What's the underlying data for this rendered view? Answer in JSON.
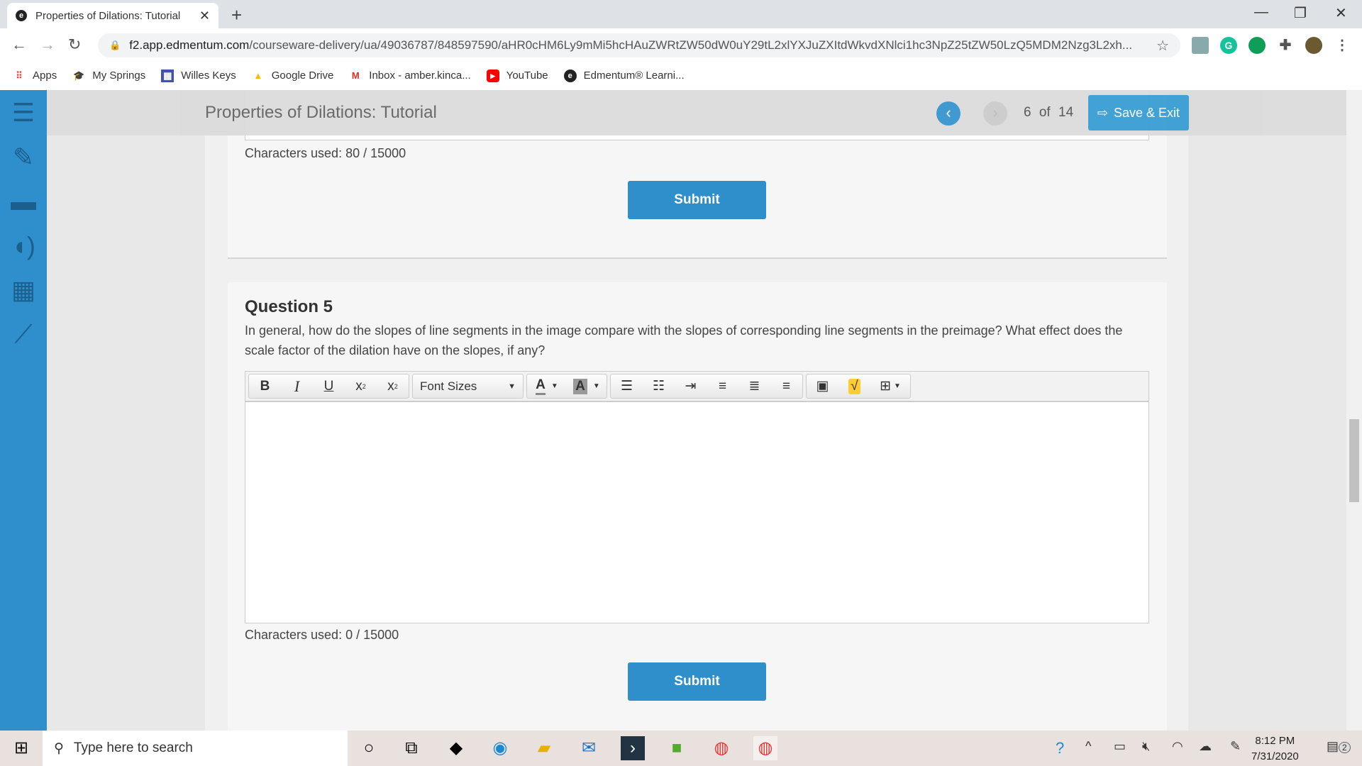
{
  "browser": {
    "tab_title": "Properties of Dilations: Tutorial",
    "url_host": "f2.app.edmentum.com",
    "url_path": "/courseware-delivery/ua/49036787/848597590/aHR0cHM6Ly9mMi5hcHAuZWRtZW50dW0uY29tL2xlYXJuZXItdWkvdXNlci1hc3NpZ25tZW50LzQ5MDM2Nzg3L2xh..."
  },
  "bookmarks": [
    {
      "label": "Apps",
      "icon": "apps-grid-icon"
    },
    {
      "label": "My Springs",
      "icon": "graduation-cap-icon"
    },
    {
      "label": "Willes Keys",
      "icon": "forms-icon"
    },
    {
      "label": "Google Drive",
      "icon": "google-drive-icon"
    },
    {
      "label": "Inbox - amber.kinca...",
      "icon": "gmail-icon"
    },
    {
      "label": "YouTube",
      "icon": "youtube-icon"
    },
    {
      "label": "Edmentum® Learni...",
      "icon": "edmentum-icon"
    }
  ],
  "header": {
    "title": "Properties of Dilations: Tutorial",
    "current": "6",
    "of": "of",
    "total": "14",
    "save_exit": "Save & Exit"
  },
  "sidebar": {
    "icons": [
      "list-icon",
      "notepad-icon",
      "folder-icon",
      "speaker-icon",
      "calculator-icon",
      "graph-icon"
    ]
  },
  "previous": {
    "chars_used": "Characters used: 80 / 15000",
    "submit": "Submit"
  },
  "question": {
    "title": "Question 5",
    "text": "In general, how do the slopes of line segments in the image compare with the slopes of corresponding line segments in the preimage? What effect does the scale factor of the dilation have on the slopes, if any?",
    "font_sizes": "Font Sizes",
    "answer": "",
    "chars_used": "Characters used: 0 / 15000",
    "submit": "Submit"
  },
  "taskbar": {
    "search_placeholder": "Type here to search",
    "time": "8:12 PM",
    "date": "7/31/2020",
    "notifications": "2"
  },
  "colors": {
    "accent": "#2f8fcb",
    "sidebar": "#2f8fcc"
  }
}
